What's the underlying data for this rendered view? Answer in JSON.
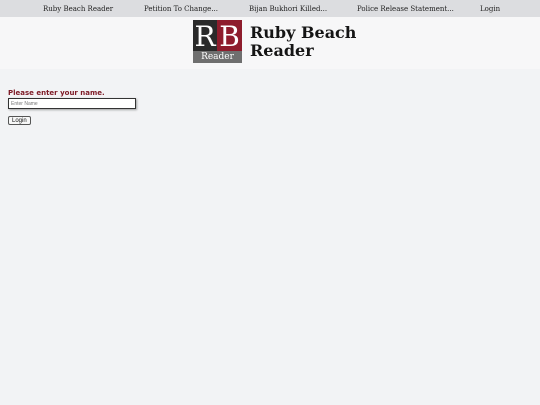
{
  "nav": {
    "items": [
      {
        "label": "Ruby Beach Reader"
      },
      {
        "label": "Petition To Change..."
      },
      {
        "label": "Bijan Bukhori Killed..."
      },
      {
        "label": "Police Release Statement..."
      },
      {
        "label": "Login"
      }
    ]
  },
  "brand": {
    "logo_r": "R",
    "logo_b": "B",
    "logo_reader": "Reader",
    "name_line1": "Ruby Beach",
    "name_line2": "Reader",
    "colors": {
      "red": "#8e1c2c",
      "dark": "#2a2a2a"
    }
  },
  "login_form": {
    "prompt": "Please enter your name.",
    "input_placeholder": "Enter Name",
    "input_value": "",
    "button_label": "Login"
  }
}
